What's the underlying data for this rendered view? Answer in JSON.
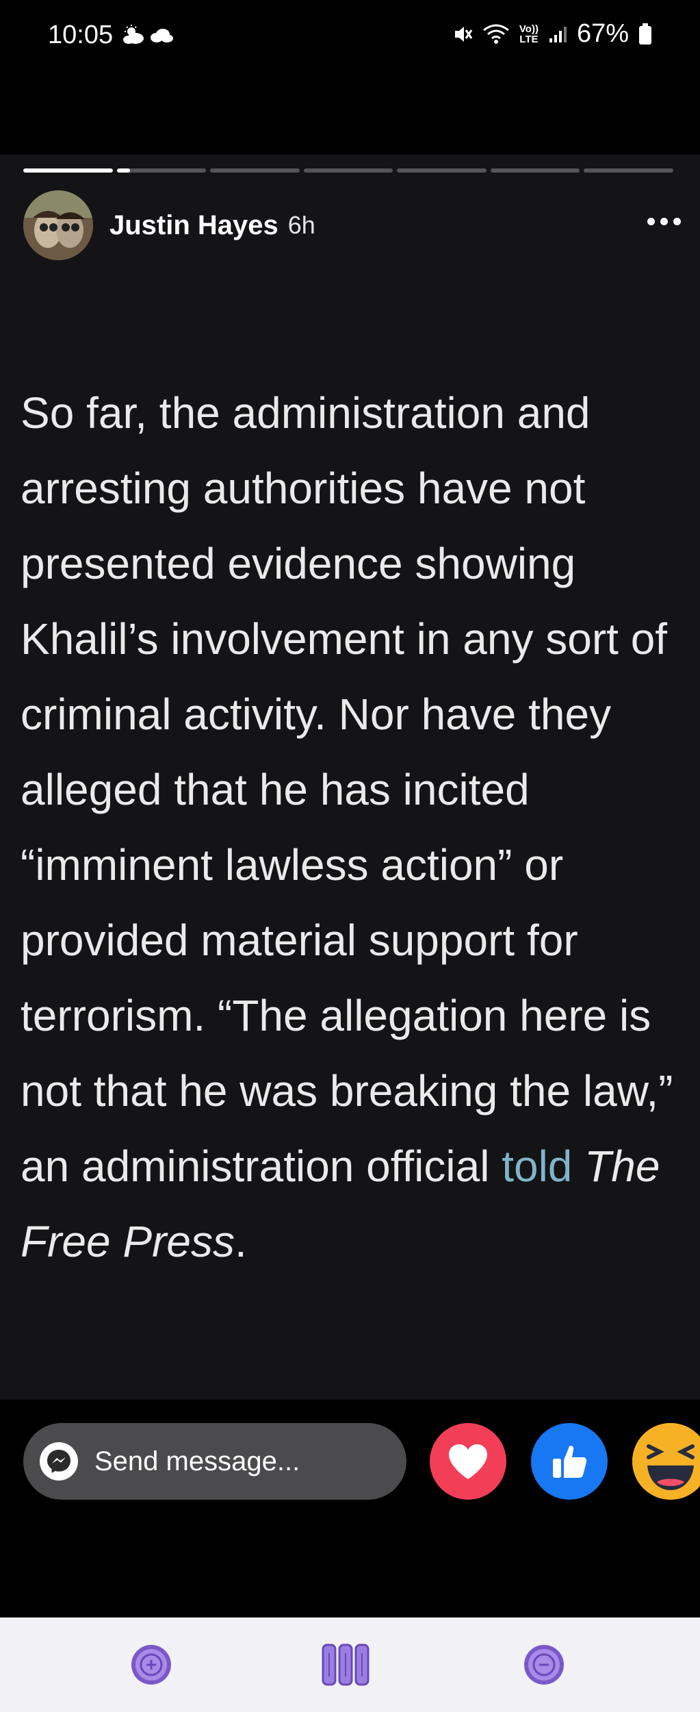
{
  "status_bar": {
    "time": "10:05",
    "volte_top": "Vo))",
    "volte_bottom": "LTE",
    "battery": "67%",
    "icons": [
      "weather-icon",
      "cloud-icon",
      "mute-icon",
      "wifi-icon",
      "volte-icon",
      "signal-icon",
      "battery-icon"
    ]
  },
  "story": {
    "progress": {
      "segments": 7,
      "current_index": 1,
      "current_fraction": 0.15
    },
    "author": {
      "name": "Justin Hayes",
      "time": "6h"
    },
    "text_part1": "So far, the administration and arresting authorities have not presented evidence showing Khalil’s involvement in any sort of criminal activity. Nor have they alleged that he has incited “imminent lawless action” or provided material support for terrorism. “The allegation here is not that he was breaking the law,” an administration official ",
    "link_text": "told",
    "publication": "The Free Press",
    "text_end": "."
  },
  "actions": {
    "send_placeholder": "Send message...",
    "reactions": [
      "love",
      "like",
      "haha"
    ]
  },
  "nav": {
    "buttons": [
      "zoom-in",
      "recents",
      "zoom-out"
    ]
  },
  "colors": {
    "story_bg": "#141417",
    "link": "#7fb4c9",
    "love": "#f33e58",
    "like": "#1877f2",
    "haha": "#f7b125",
    "nav_accent": "#9b7fe0"
  }
}
